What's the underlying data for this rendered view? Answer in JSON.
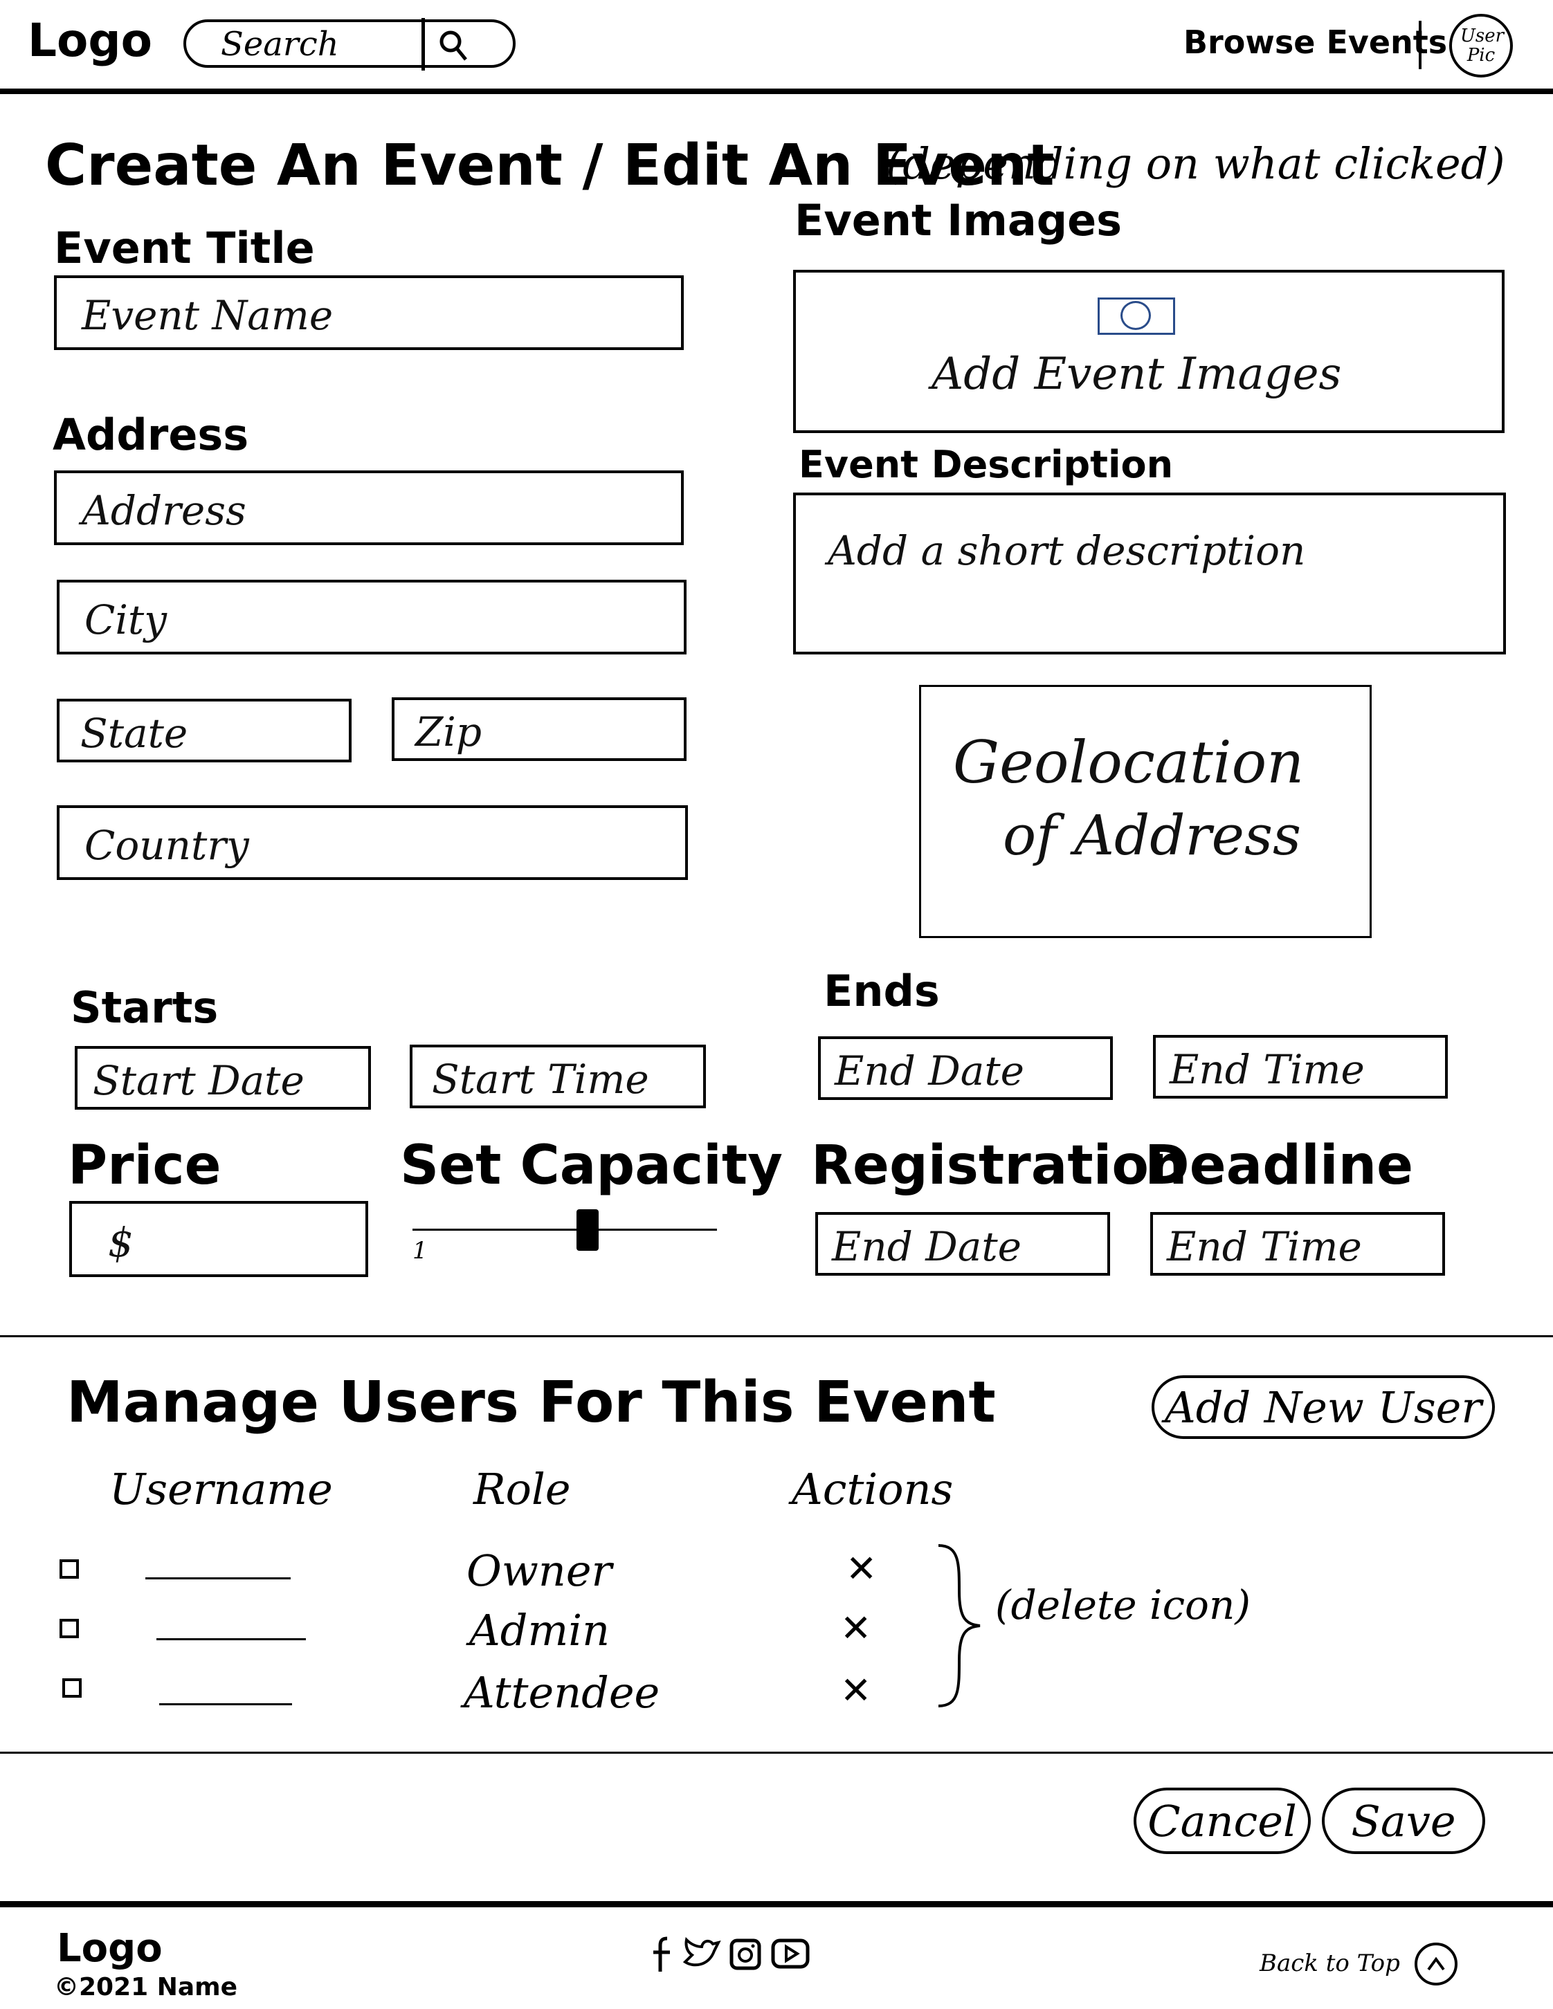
{
  "header": {
    "logo": "Logo",
    "search_placeholder": "Search",
    "browse_label": "Browse Events",
    "avatar_label": "User Pic"
  },
  "page": {
    "title": "Create An Event / Edit An Event",
    "title_note": "(depending on what clicked)"
  },
  "form": {
    "event_title_label": "Event Title",
    "event_name_placeholder": "Event Name",
    "address_label": "Address",
    "address_placeholder": "Address",
    "city_placeholder": "City",
    "state_placeholder": "State",
    "zip_placeholder": "Zip",
    "country_placeholder": "Country",
    "images_label": "Event Images",
    "images_button": "Add Event Images",
    "description_label": "Event Description",
    "description_placeholder": "Add a short description",
    "geolocation_line1": "Geolocation",
    "geolocation_line2": "of Address",
    "starts_label": "Starts",
    "start_date_placeholder": "Start Date",
    "start_time_placeholder": "Start Time",
    "ends_label": "Ends",
    "end_date_placeholder": "End Date",
    "end_time_placeholder": "End Time",
    "price_label": "Price",
    "price_placeholder": "$",
    "capacity_label": "Set Capacity",
    "capacity_min": "1",
    "capacity_value_fraction": 0.58,
    "registration_label": "Registration",
    "deadline_label": "Deadline",
    "reg_end_date_placeholder": "End Date",
    "reg_end_time_placeholder": "End Time"
  },
  "users": {
    "section_title": "Manage Users For This Event",
    "add_button": "Add New User",
    "col_username": "Username",
    "col_role": "Role",
    "col_actions": "Actions",
    "rows": [
      {
        "role": "Owner",
        "action": "✕"
      },
      {
        "role": "Admin",
        "action": "✕"
      },
      {
        "role": "Attendee",
        "action": "✕"
      }
    ],
    "delete_note": "(delete icon)"
  },
  "actions": {
    "cancel": "Cancel",
    "save": "Save"
  },
  "footer": {
    "logo": "Logo",
    "copyright": "©2021 Name",
    "social_icons": [
      "facebook-icon",
      "twitter-icon",
      "instagram-icon",
      "youtube-icon"
    ],
    "back_to_top": "Back to Top"
  }
}
